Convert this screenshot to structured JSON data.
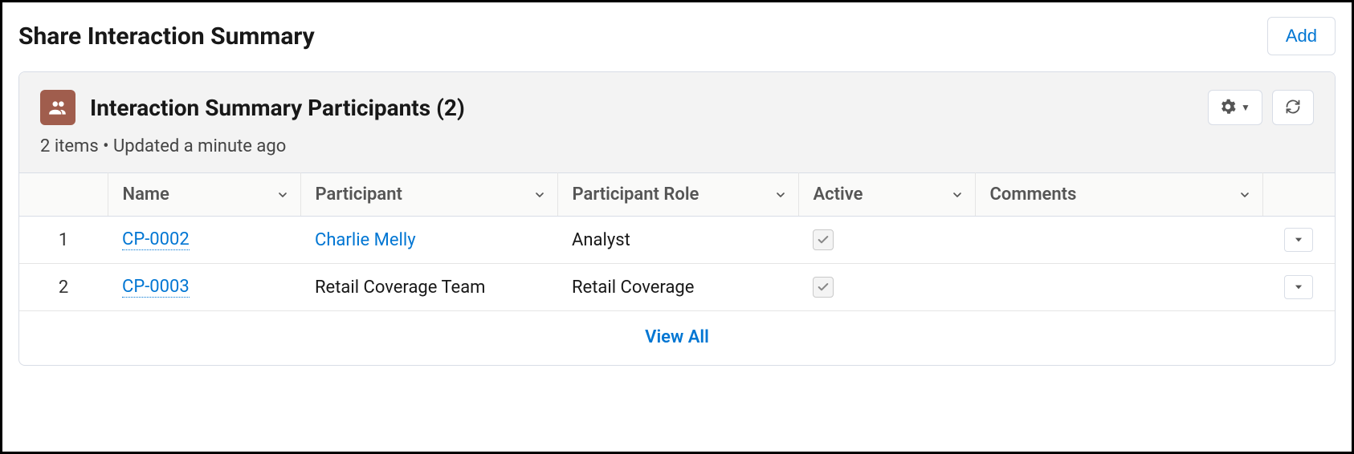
{
  "header": {
    "page_title": "Share Interaction Summary",
    "add_label": "Add"
  },
  "card": {
    "title": "Interaction Summary Participants (2)",
    "subtitle": "2 items • Updated a minute ago",
    "settings_icon": "gear-icon",
    "refresh_icon": "refresh-icon"
  },
  "table": {
    "columns": {
      "name": "Name",
      "participant": "Participant",
      "role": "Participant Role",
      "active": "Active",
      "comments": "Comments"
    },
    "rows": [
      {
        "num": "1",
        "name": "CP-0002",
        "participant": "Charlie Melly",
        "participant_is_link": true,
        "role": "Analyst",
        "active": true,
        "comments": ""
      },
      {
        "num": "2",
        "name": "CP-0003",
        "participant": "Retail Coverage Team",
        "participant_is_link": false,
        "role": "Retail Coverage",
        "active": true,
        "comments": ""
      }
    ]
  },
  "footer": {
    "view_all": "View All"
  }
}
